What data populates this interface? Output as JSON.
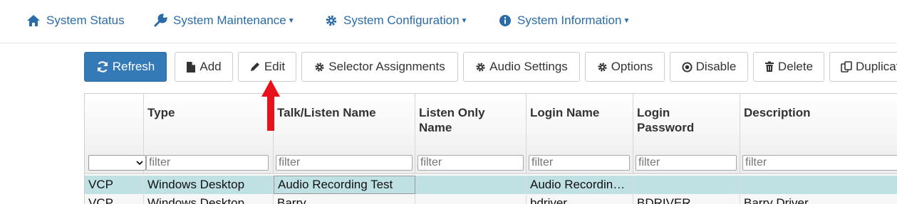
{
  "nav": {
    "items": [
      {
        "label": "System Status",
        "icon": "home-icon",
        "dropdown": false
      },
      {
        "label": "System Maintenance",
        "icon": "wrench-icon",
        "dropdown": true
      },
      {
        "label": "System Configuration",
        "icon": "gear-icon",
        "dropdown": true
      },
      {
        "label": "System Information",
        "icon": "info-circle-icon",
        "dropdown": true
      }
    ],
    "color": "#2a6ca8"
  },
  "toolbar": {
    "buttons": [
      {
        "label": "Refresh",
        "icon": "refresh-icon",
        "primary": true
      },
      {
        "label": "Add",
        "icon": "file-icon"
      },
      {
        "label": "Edit",
        "icon": "pencil-icon"
      },
      {
        "label": "Selector Assignments",
        "icon": "gear-icon"
      },
      {
        "label": "Audio Settings",
        "icon": "gear-icon"
      },
      {
        "label": "Options",
        "icon": "gear-icon"
      },
      {
        "label": "Disable",
        "icon": "disable-circle-icon"
      },
      {
        "label": "Delete",
        "icon": "trash-icon"
      },
      {
        "label": "Duplicate",
        "icon": "copy-icon"
      }
    ],
    "primary_color": "#337ab7"
  },
  "grid": {
    "columns": [
      {
        "title": "",
        "filter_placeholder": "",
        "type": "select"
      },
      {
        "title": "Type",
        "filter_placeholder": "filter"
      },
      {
        "title": "Talk/Listen Name",
        "filter_placeholder": "filter"
      },
      {
        "title": "Listen Only Name",
        "filter_placeholder": "filter"
      },
      {
        "title": "Login Name",
        "filter_placeholder": "filter"
      },
      {
        "title": "Login Password",
        "filter_placeholder": "filter"
      },
      {
        "title": "Description",
        "filter_placeholder": "filter"
      }
    ],
    "rows": [
      {
        "selected": true,
        "cells": [
          "VCP",
          "Windows Desktop",
          "Audio Recording Test",
          "",
          "Audio Recordin…",
          "",
          ""
        ]
      },
      {
        "selected": false,
        "cells": [
          "VCP",
          "Windows Desktop",
          "Barry",
          "",
          "bdriver",
          "BDRIVER",
          "Barry Driver"
        ]
      }
    ],
    "selected_row_color": "#bfe1e4"
  },
  "annotation": {
    "color": "#e8121b"
  }
}
